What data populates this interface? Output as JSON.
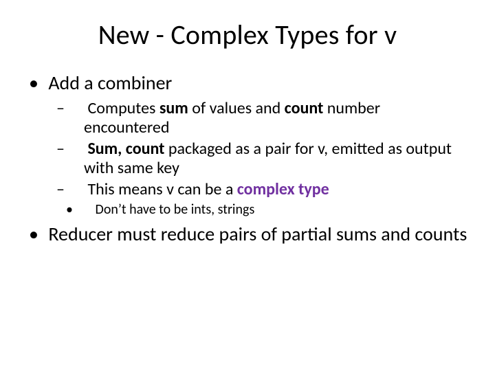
{
  "title": "New - Complex Types for v",
  "bullets": {
    "b1": "Add a combiner",
    "b1_sub": {
      "s1_pre": "Computes ",
      "s1_bold1": "sum",
      "s1_mid": " of values and ",
      "s1_bold2": "count",
      "s1_post": " number encountered",
      "s2_bold": "Sum, count",
      "s2_post": " packaged as a pair for v, emitted as output with same key",
      "s3_pre": "This means v can be a ",
      "s3_accent": "complex type",
      "s3_sub1": "Don’t have to be ints, strings"
    },
    "b2": "Reducer must reduce pairs of partial sums and counts"
  }
}
